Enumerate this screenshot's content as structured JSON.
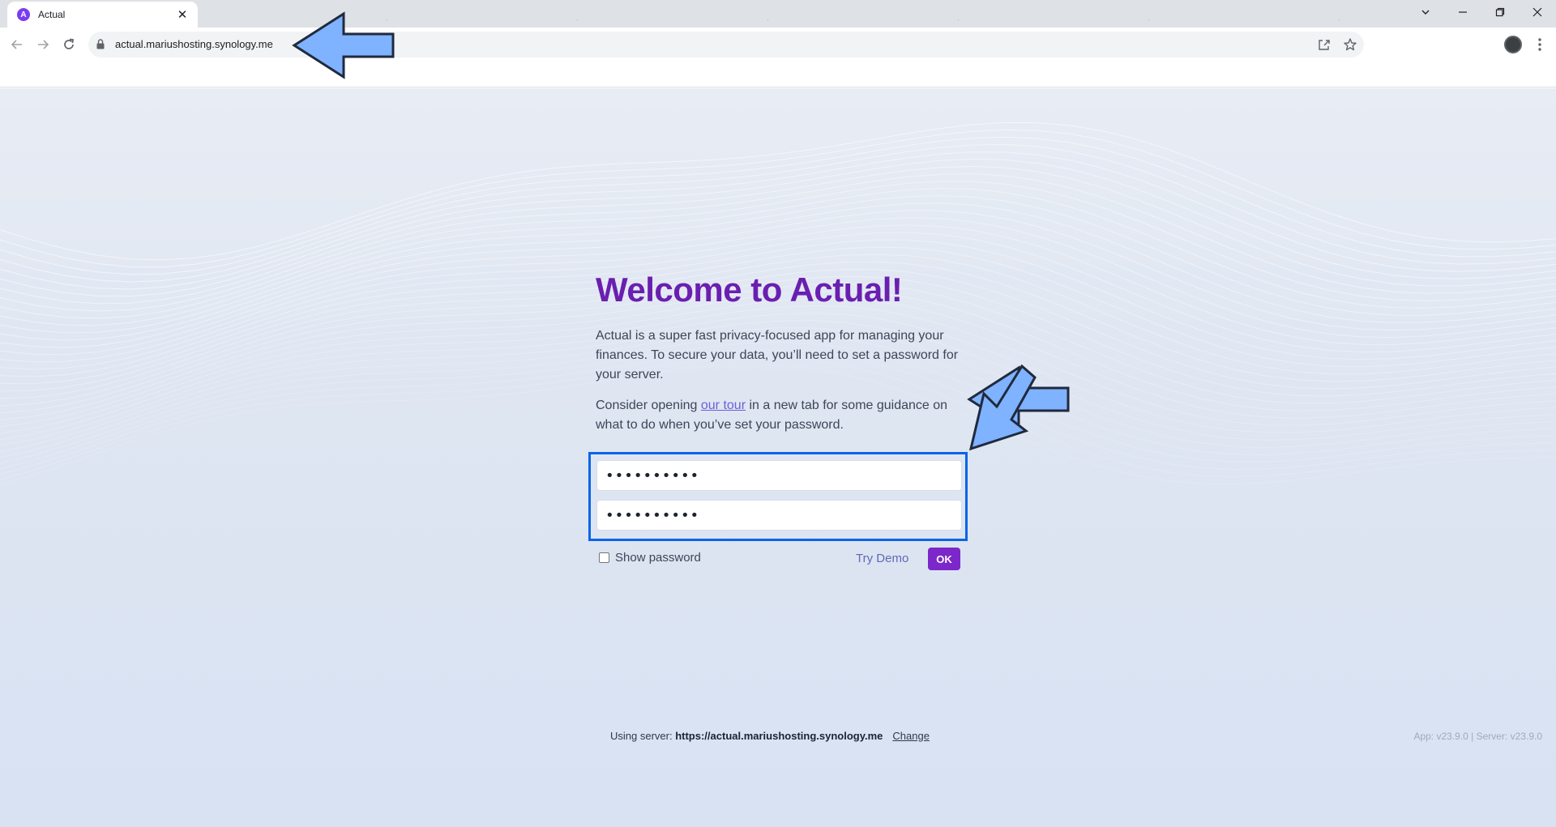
{
  "browser": {
    "tab_title": "Actual",
    "favicon_letter": "A",
    "url": "actual.mariushosting.synology.me",
    "icons": [
      "back-icon",
      "forward-icon",
      "reload-icon",
      "lock-icon",
      "share-icon",
      "star-icon",
      "menu-icon",
      "minimize-icon",
      "maximize-icon",
      "close-icon"
    ]
  },
  "welcome": {
    "title": "Welcome to Actual!",
    "intro": "Actual is a super fast privacy-focused app for managing your finances. To secure your data, you’ll need to set a password for your server.",
    "tour_before": "Consider opening ",
    "tour_link": "our tour",
    "tour_after": " in a new tab for some guidance on what to do when you’ve set your password."
  },
  "form": {
    "password_value": "••••••••••",
    "confirm_value": "••••••••••",
    "show_password_label": "Show password",
    "try_demo_label": "Try Demo",
    "ok_label": "OK"
  },
  "footer": {
    "using_server_label": "Using server: ",
    "server_url": "https://actual.mariushosting.synology.me",
    "change_label": "Change",
    "version": "App: v23.9.0 | Server: v23.9.0"
  },
  "colors": {
    "accent": "#6a1fb0",
    "button": "#7c27c9",
    "highlight_box": "#0a64e8",
    "annotation_arrow": "#7fb2ff"
  }
}
